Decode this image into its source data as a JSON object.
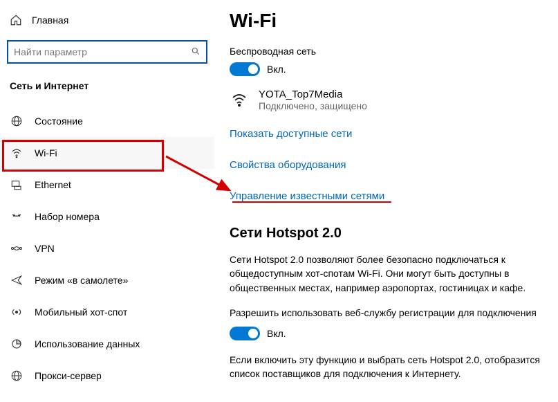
{
  "sidebar": {
    "home_label": "Главная",
    "search_placeholder": "Найти параметр",
    "section_title": "Сеть и Интернет",
    "items": [
      {
        "label": "Состояние"
      },
      {
        "label": "Wi-Fi"
      },
      {
        "label": "Ethernet"
      },
      {
        "label": "Набор номера"
      },
      {
        "label": "VPN"
      },
      {
        "label": "Режим «в самолете»"
      },
      {
        "label": "Мобильный хот-спот"
      },
      {
        "label": "Использование данных"
      },
      {
        "label": "Прокси-сервер"
      }
    ]
  },
  "content": {
    "title": "Wi-Fi",
    "wireless_label": "Беспроводная сеть",
    "toggle_on_label": "Вкл.",
    "network": {
      "name": "YOTA_Top7Media",
      "status": "Подключено, защищено"
    },
    "links": {
      "show_available": "Показать доступные сети",
      "hw_props": "Свойства оборудования",
      "manage_known": "Управление известными сетями"
    },
    "hotspot": {
      "heading": "Сети Hotspot 2.0",
      "desc": "Сети Hotspot 2.0 позволяют более безопасно подключаться к общедоступным хот-спотам Wi-Fi. Они могут быть доступны в общественных местах, например аэропортах, гостиницах и кафе.",
      "allow_web_reg": "Разрешить использовать веб-службу регистрации для подключения",
      "toggle_label": "Вкл.",
      "note": "Если включить эту функцию и выбрать сеть Hotspot 2.0, отобразится список поставщиков для подключения к Интернету."
    }
  },
  "colors": {
    "accent": "#0078d4",
    "link": "#0068b8",
    "annotation": "#d40000"
  }
}
